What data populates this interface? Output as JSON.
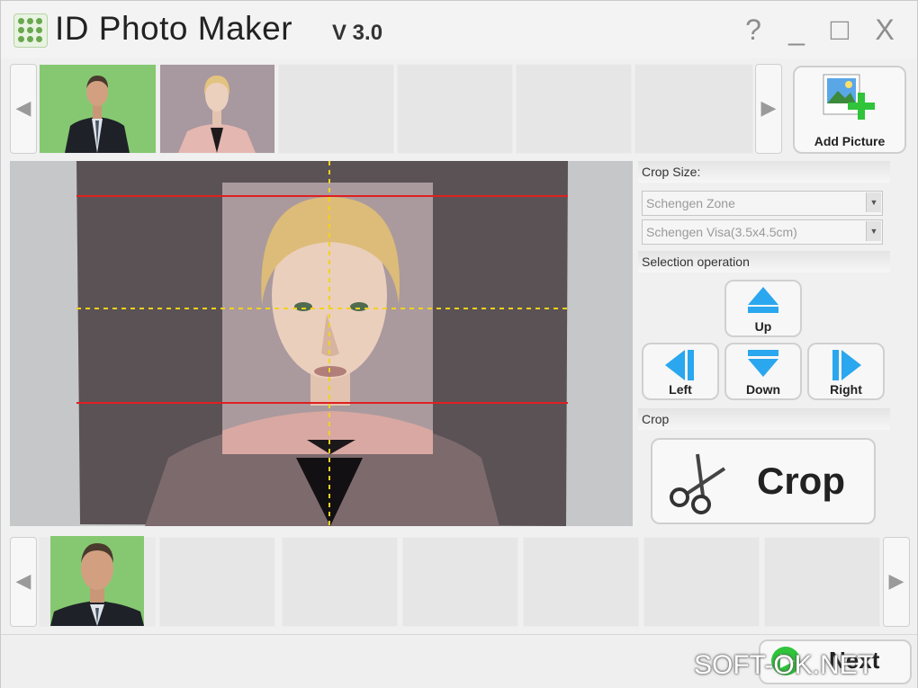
{
  "window": {
    "title": "ID Photo Maker",
    "version": "V 3.0",
    "help_glyph": "?",
    "minimize_glyph": "_",
    "maximize_glyph": "□",
    "close_glyph": "X"
  },
  "source_strip": {
    "prev_glyph": "◀",
    "next_glyph": "▶",
    "thumbnails": [
      "man-green-background-photo",
      "woman-pink-jacket-photo"
    ],
    "empty_slots": 4
  },
  "add_picture": {
    "label": "Add Picture",
    "icon": "add-picture-icon"
  },
  "panel": {
    "crop_size_header": "Crop Size:",
    "region_value": "Schengen Zone",
    "size_value": "Schengen Visa(3.5x4.5cm)",
    "selection_header": "Selection operation",
    "up_label": "Up",
    "left_label": "Left",
    "down_label": "Down",
    "right_label": "Right",
    "crop_header": "Crop",
    "crop_label": "Crop"
  },
  "result_strip": {
    "prev_glyph": "◀",
    "next_glyph": "▶",
    "thumbnails": [
      "man-cropped-headshot"
    ],
    "empty_slots": 6
  },
  "next_button": {
    "label": "Next"
  },
  "watermark": "SOFT-OK.NET",
  "colors": {
    "guide_red": "#e02020",
    "guide_yellow": "#f2d21b",
    "arrow_blue": "#2aa7ee",
    "add_green": "#2fc43a",
    "photo_bg_green": "#86c871"
  }
}
